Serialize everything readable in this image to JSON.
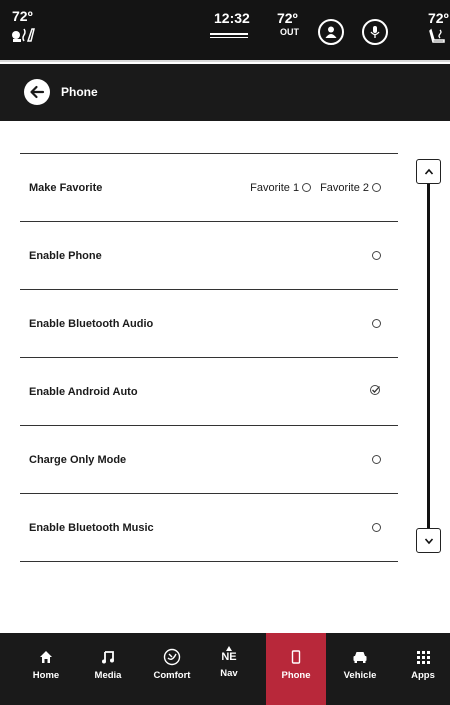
{
  "status_bar": {
    "driver_temp": "72º",
    "clock": "12:32",
    "outside_temp": "72º",
    "outside_label": "OUT",
    "passenger_temp": "72º",
    "icons": [
      "heated-seat-icon",
      "profile-icon",
      "voice-mic-icon",
      "heated-seat-passenger-icon"
    ]
  },
  "header": {
    "title": "Phone",
    "back_icon": "back-arrow-icon"
  },
  "settings": {
    "make_favorite": {
      "label": "Make Favorite",
      "option1": "Favorite 1",
      "option2": "Favorite 2"
    },
    "items": [
      {
        "label": "Enable Phone",
        "checked": false
      },
      {
        "label": "Enable Bluetooth Audio",
        "checked": false
      },
      {
        "label": "Enable Android Auto",
        "checked": true
      },
      {
        "label": "Charge Only Mode",
        "checked": false
      },
      {
        "label": "Enable Bluetooth Music",
        "checked": false
      }
    ]
  },
  "scrollbar": {
    "up_icon": "chevron-up-icon",
    "down_icon": "chevron-down-icon"
  },
  "bottom_nav": {
    "active": "Phone",
    "accent_color": "#b8283a",
    "items": [
      {
        "label": "Home",
        "icon": "home-icon"
      },
      {
        "label": "Media",
        "icon": "music-note-icon"
      },
      {
        "label": "Comfort",
        "icon": "comfort-icon"
      },
      {
        "label": "Nav",
        "icon": "compass-icon",
        "heading": "NE"
      },
      {
        "label": "Phone",
        "icon": "phone-icon"
      },
      {
        "label": "Vehicle",
        "icon": "car-icon"
      },
      {
        "label": "Apps",
        "icon": "apps-grid-icon"
      }
    ]
  }
}
